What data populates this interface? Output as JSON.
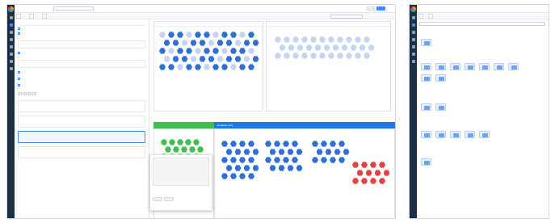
{
  "colors": {
    "accent": "#3d8bfd",
    "rail": "#1d2f45",
    "danger": "#e14343",
    "success": "#3fbf4f",
    "database": "#1f7be0",
    "lavender": "#8b7cf6"
  },
  "left": {
    "crumb": "",
    "title": "",
    "save_label": "",
    "cancel_label": "",
    "tabs": [
      "",
      "",
      ""
    ],
    "panel_rows": [
      "",
      "",
      "",
      "",
      "",
      "",
      "",
      "",
      "",
      ""
    ],
    "chips": [
      "",
      "",
      "",
      ""
    ],
    "panels": {
      "a": "",
      "b": ""
    },
    "database_band": "Database (31)",
    "tooltip_title": ""
  },
  "right": {
    "title": "",
    "section_labels": [
      "",
      "",
      "",
      "",
      ""
    ]
  }
}
